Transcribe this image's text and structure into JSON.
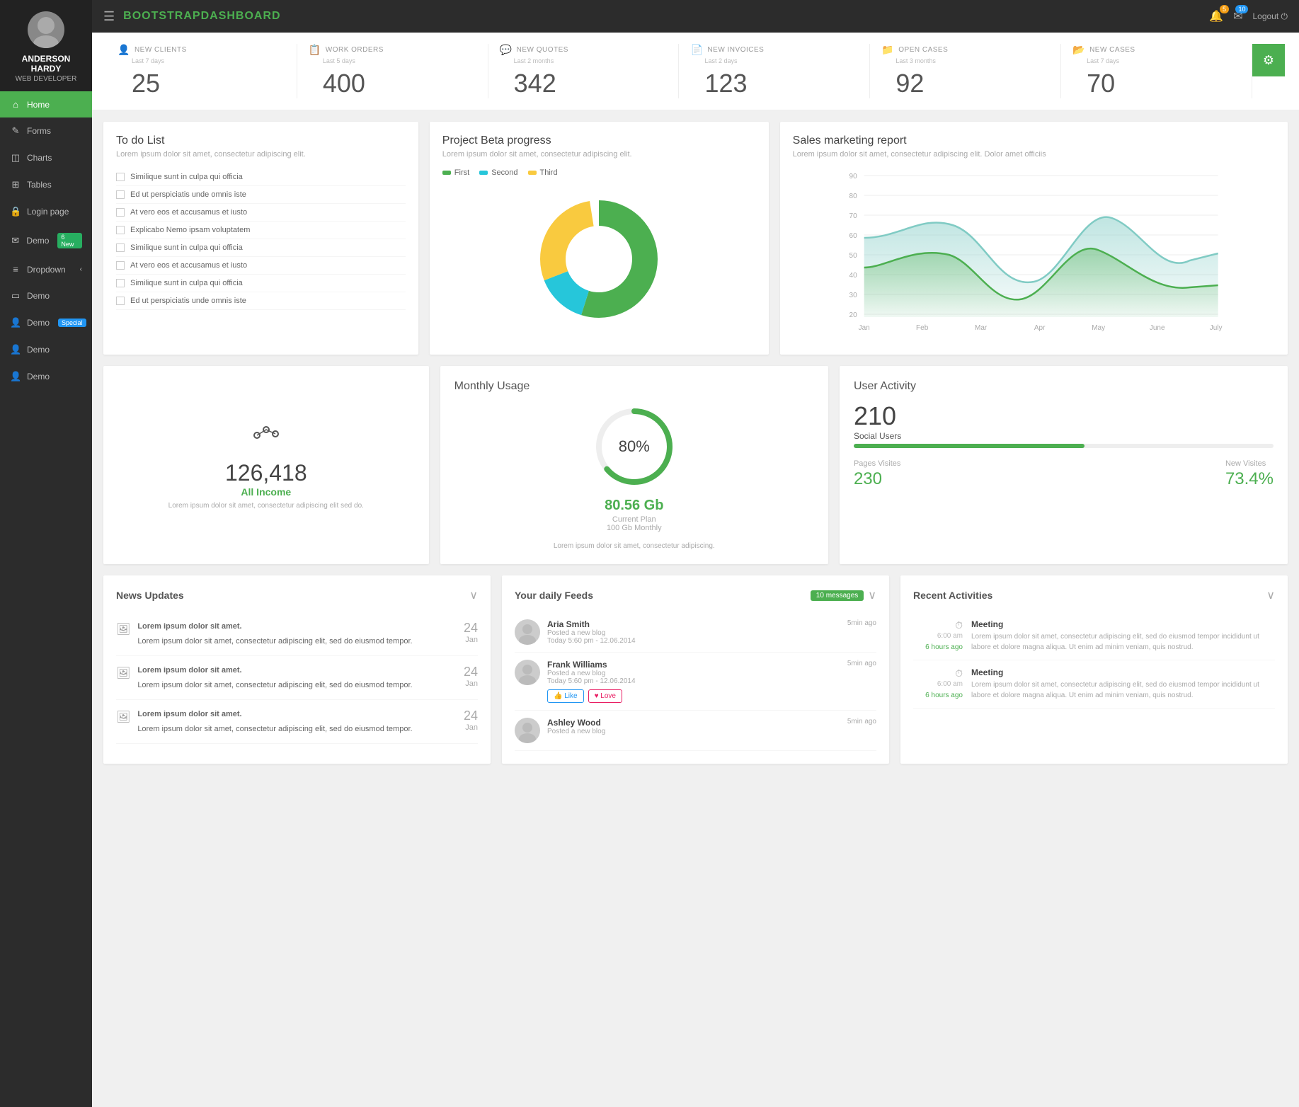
{
  "app": {
    "title_plain": "BOOTSTRAP",
    "title_bold": "DASHBOARD",
    "menu_icon": "☰",
    "logout_label": "Logout"
  },
  "topbar": {
    "notif_count": "5",
    "msg_count": "10"
  },
  "sidebar": {
    "user_name": "ANDERSON HARDY",
    "user_role": "WEB DEVELOPER",
    "items": [
      {
        "label": "Home",
        "icon": "⌂",
        "active": true
      },
      {
        "label": "Forms",
        "icon": "✎",
        "active": false
      },
      {
        "label": "Charts",
        "icon": "📊",
        "active": false
      },
      {
        "label": "Tables",
        "icon": "⊞",
        "active": false
      },
      {
        "label": "Login page",
        "icon": "🔑",
        "active": false
      },
      {
        "label": "Demo",
        "icon": "✉",
        "badge": "6 New",
        "active": false
      },
      {
        "label": "Dropdown",
        "icon": "▾",
        "chevron": true,
        "active": false
      },
      {
        "label": "Demo",
        "icon": "🖥",
        "active": false
      },
      {
        "label": "Demo",
        "icon": "👤",
        "badge_special": "Special",
        "active": false
      },
      {
        "label": "Demo",
        "icon": "👤",
        "active": false
      },
      {
        "label": "Demo",
        "icon": "👤",
        "active": false
      }
    ]
  },
  "stats": [
    {
      "icon": "👤",
      "label": "NEW CLIENTS",
      "sublabel": "Last 7 days",
      "value": "25"
    },
    {
      "icon": "📋",
      "label": "WORK ORDERS",
      "sublabel": "Last 5 days",
      "value": "400"
    },
    {
      "icon": "💬",
      "label": "NEW QUOTES",
      "sublabel": "Last 2 months",
      "value": "342"
    },
    {
      "icon": "📄",
      "label": "NEW INVOICES",
      "sublabel": "Last 2 days",
      "value": "123"
    },
    {
      "icon": "📁",
      "label": "OPEN CASES",
      "sublabel": "Last 3 months",
      "value": "92"
    },
    {
      "icon": "📂",
      "label": "NEW CASES",
      "sublabel": "Last 7 days",
      "value": "70"
    }
  ],
  "todo": {
    "title": "To do List",
    "subtitle": "Lorem ipsum dolor sit amet, consectetur adipiscing elit.",
    "items": [
      "Similique sunt in culpa qui officia",
      "Ed ut perspiciatis unde omnis iste",
      "At vero eos et accusamus et iusto",
      "Explicabo Nemo ipsam voluptatem",
      "Similique sunt in culpa qui officia",
      "At vero eos et accusamus et iusto",
      "Similique sunt in culpa qui officia",
      "Ed ut perspiciatis unde omnis iste"
    ]
  },
  "donut": {
    "title": "Project Beta progress",
    "subtitle": "Lorem ipsum dolor sit amet, consectetur adipiscing elit.",
    "legend": [
      {
        "label": "First",
        "color": "#4caf50"
      },
      {
        "label": "Second",
        "color": "#26c6da"
      },
      {
        "label": "Third",
        "color": "#f9ca3f"
      }
    ]
  },
  "sales_chart": {
    "title": "Sales marketing report",
    "subtitle": "Lorem ipsum dolor sit amet, consectetur adipiscing elit. Dolor amet officiis",
    "months": [
      "Jan",
      "Feb",
      "Mar",
      "Apr",
      "May",
      "June",
      "July"
    ],
    "y_labels": [
      "20",
      "30",
      "40",
      "50",
      "60",
      "70",
      "80",
      "90"
    ]
  },
  "income": {
    "value": "126,418",
    "label": "All Income",
    "desc": "Lorem ipsum dolor sit amet, consectetur adipiscing elit sed do."
  },
  "monthly": {
    "title": "Monthly Usage",
    "percent": "80%",
    "gb": "80.56 Gb",
    "plan_label": "Current Plan",
    "plan_value": "100 Gb Monthly",
    "footer": "Lorem ipsum dolor sit amet, consectetur adipiscing."
  },
  "user_activity": {
    "title": "User Activity",
    "number": "210",
    "social_label": "Social Users",
    "bar_pct": 55,
    "pages_label": "Pages Visites",
    "pages_value": "230",
    "new_visites_label": "New Visites",
    "new_visites_value": "73.4%"
  },
  "news": {
    "title": "News Updates",
    "items": [
      {
        "title": "Lorem ipsum dolor sit amet.",
        "desc": "Lorem ipsum dolor sit amet, consectetur adipiscing elit, sed do eiusmod tempor.",
        "day": "24",
        "month": "Jan"
      },
      {
        "title": "Lorem ipsum dolor sit amet.",
        "desc": "Lorem ipsum dolor sit amet, consectetur adipiscing elit, sed do eiusmod tempor.",
        "day": "24",
        "month": "Jan"
      },
      {
        "title": "Lorem ipsum dolor sit amet.",
        "desc": "Lorem ipsum dolor sit amet, consectetur adipiscing elit, sed do eiusmod tempor.",
        "day": "24",
        "month": "Jan"
      }
    ]
  },
  "feeds": {
    "title": "Your daily Feeds",
    "badge": "10 messages",
    "items": [
      {
        "name": "Aria Smith",
        "action": "Posted a new blog",
        "time_detail": "Today 5:60 pm - 12.06.2014",
        "ago": "5min ago",
        "has_actions": false
      },
      {
        "name": "Frank Williams",
        "action": "Posted a new blog",
        "time_detail": "Today 5:60 pm - 12.06.2014",
        "ago": "5min ago",
        "has_actions": true
      },
      {
        "name": "Ashley Wood",
        "action": "Posted a new blog",
        "time_detail": "",
        "ago": "5min ago",
        "has_actions": false
      }
    ]
  },
  "activities": {
    "title": "Recent Activities",
    "items": [
      {
        "time": "6:00 am",
        "time_link": "6 hours ago",
        "title": "Meeting",
        "desc": "Lorem ipsum dolor sit amet, consectetur adipiscing elit, sed do eiusmod tempor incididunt ut labore et dolore magna aliqua. Ut enim ad minim veniam, quis nostrud."
      },
      {
        "time": "6:00 am",
        "time_link": "6 hours ago",
        "title": "Meeting",
        "desc": "Lorem ipsum dolor sit amet, consectetur adipiscing elit, sed do eiusmod tempor incididunt ut labore et dolore magna aliqua. Ut enim ad minim veniam, quis nostrud."
      }
    ]
  }
}
